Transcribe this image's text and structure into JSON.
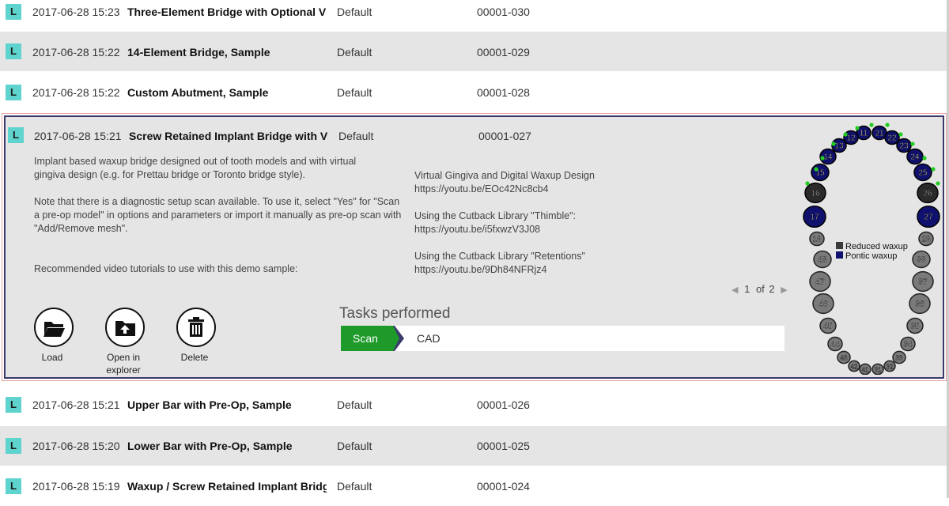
{
  "rows_top": [
    {
      "badge": "L",
      "date": "2017-06-28 15:23",
      "name": "Three-Element Bridge with Optional Vi",
      "lab": "Default",
      "code": "00001-030"
    },
    {
      "badge": "L",
      "date": "2017-06-28 15:22",
      "name": "14-Element Bridge, Sample",
      "lab": "Default",
      "code": "00001-029"
    },
    {
      "badge": "L",
      "date": "2017-06-28 15:22",
      "name": "Custom Abutment, Sample",
      "lab": "Default",
      "code": "00001-028"
    }
  ],
  "expanded": {
    "badge": "L",
    "date": "2017-06-28 15:21",
    "name": "Screw Retained Implant Bridge with Vi",
    "lab": "Default",
    "code": "00001-027",
    "desc1": "Implant based waxup bridge designed out of tooth models and with virtual gingiva design (e.g. for Prettau bridge or Toronto bridge style).",
    "desc2": "Note that there is a diagnostic setup scan available. To use it, select \"Yes\" for \"Scan a pre-op model\" in options and parameters or import it manually as pre-op scan with \"Add/Remove mesh\".",
    "desc3": "Recommended video tutorials to use with this demo sample:",
    "tutorials": [
      {
        "title": "Virtual Gingiva and Digital Waxup Design",
        "url": "https://youtu.be/EOc42Nc8cb4"
      },
      {
        "title": "Using the Cutback Library \"Thimble\":",
        "url": "https://youtu.be/i5fxwzV3J08"
      },
      {
        "title": "Using the Cutback Library \"Retentions\"",
        "url": "https://youtu.be/9Dh84NFRjz4"
      }
    ],
    "actions": {
      "load": "Load",
      "open": "Open in explorer",
      "delete": "Delete"
    },
    "tasks_title": "Tasks performed",
    "tasks": {
      "scan": "Scan",
      "cad": "CAD"
    },
    "pager": {
      "current": "1",
      "of": "of",
      "total": "2"
    },
    "legend": {
      "reduced": "Reduced waxup",
      "pontic": "Pontic waxup"
    },
    "colors": {
      "reduced": "#3a3a3a",
      "pontic": "#10106e",
      "scan": "#1e9a2a",
      "badge": "#5fd3ce",
      "marker": "#22cc22"
    }
  },
  "teeth": {
    "upper": [
      "11",
      "12",
      "13",
      "14",
      "15",
      "16",
      "17",
      "18",
      "21",
      "22",
      "23",
      "24",
      "25",
      "26",
      "27",
      "28"
    ],
    "lower": [
      "31",
      "32",
      "33",
      "34",
      "35",
      "36",
      "37",
      "38",
      "41",
      "42",
      "43",
      "44",
      "45",
      "46",
      "47",
      "48"
    ]
  },
  "rows_bottom": [
    {
      "badge": "L",
      "date": "2017-06-28 15:21",
      "name": "Upper Bar with Pre-Op, Sample",
      "lab": "Default",
      "code": "00001-026"
    },
    {
      "badge": "L",
      "date": "2017-06-28 15:20",
      "name": "Lower Bar with Pre-Op, Sample",
      "lab": "Default",
      "code": "00001-025"
    },
    {
      "badge": "L",
      "date": "2017-06-28 15:19",
      "name": "Waxup / Screw Retained Implant Bridg",
      "lab": "Default",
      "code": "00001-024"
    }
  ]
}
